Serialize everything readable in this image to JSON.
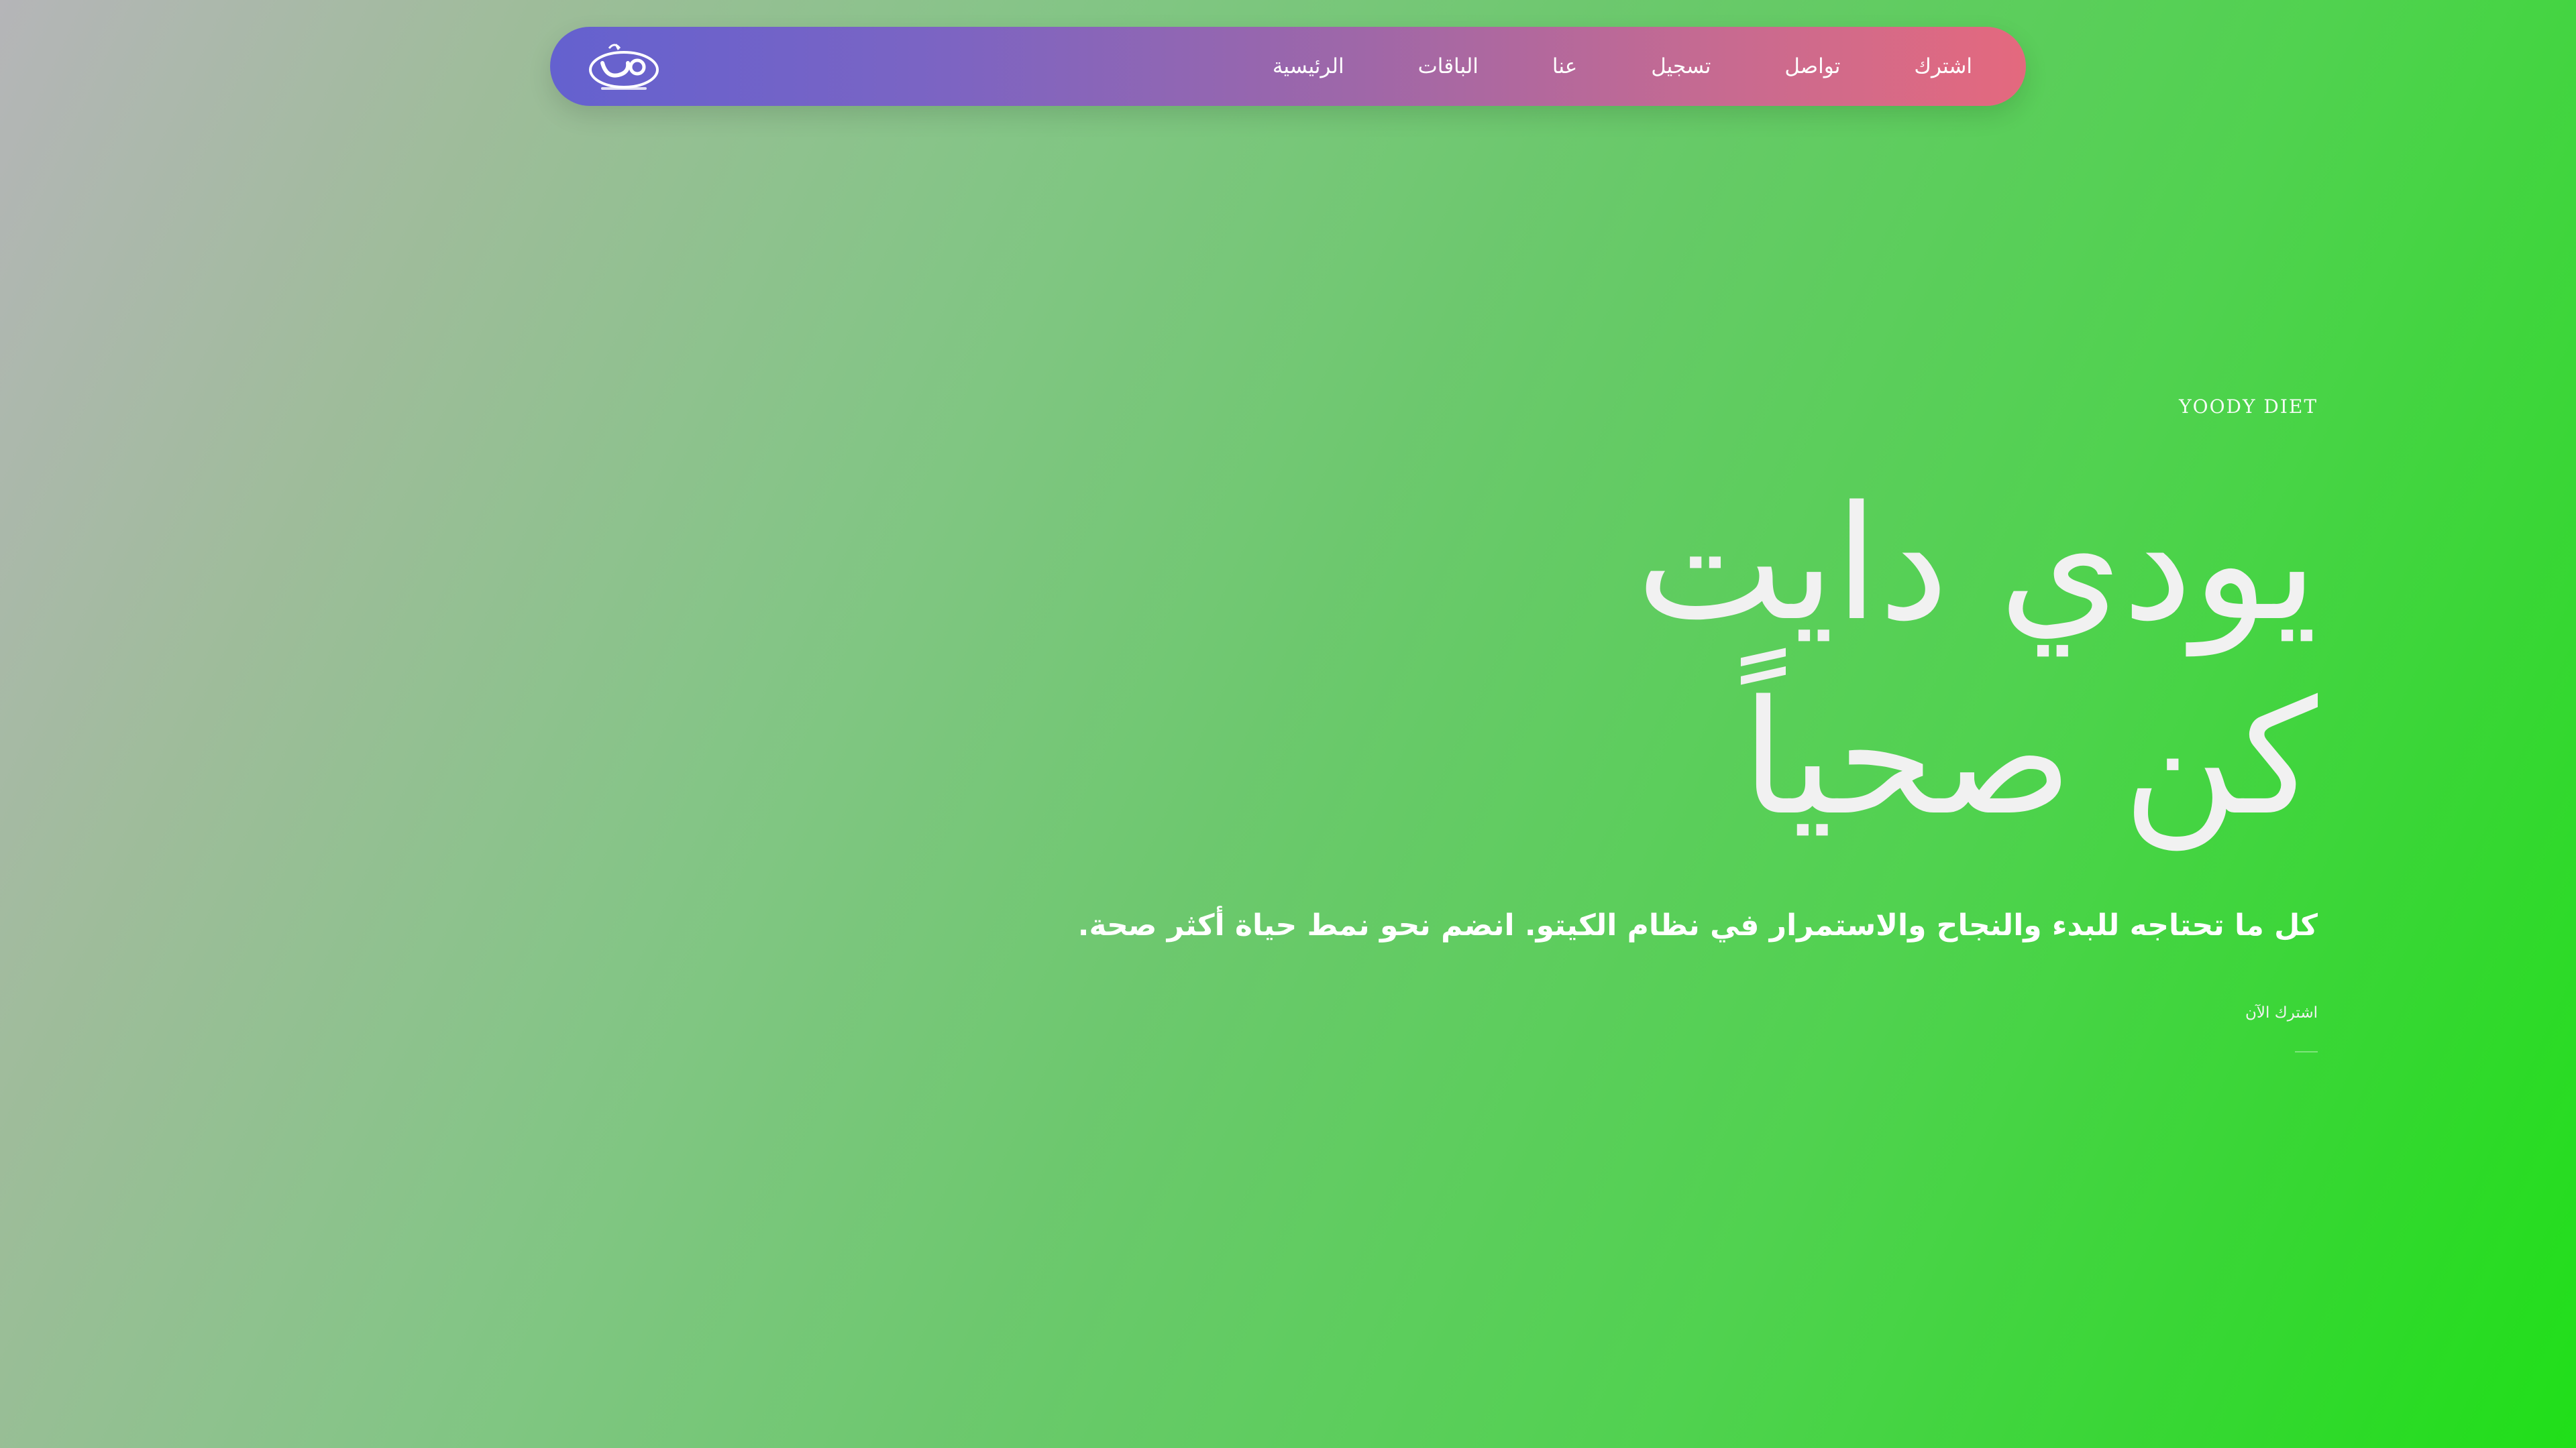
{
  "nav": {
    "logo_icon": "yoody-logo-icon",
    "links": [
      {
        "label": "اشترك"
      },
      {
        "label": "تواصل"
      },
      {
        "label": "تسجيل"
      },
      {
        "label": "عنا"
      },
      {
        "label": "الباقات"
      },
      {
        "label": "الرئيسية"
      }
    ]
  },
  "hero": {
    "eyebrow": "YOODY DIET",
    "headline_line1": "يودي دايت",
    "headline_line2": "كن صحياً",
    "subtitle": "كل ما تحتاجه للبدء والنجاح والاستمرار في نظام الكيتو. انضم نحو نمط حياة أكثر صحة.",
    "cta_label": "اشترك الآن"
  },
  "colors": {
    "nav_gradient_start": "#6461cf",
    "nav_gradient_end": "#e4697e",
    "background_start": "#b5b5b8",
    "background_end": "#20df19",
    "text": "#ffffff"
  }
}
